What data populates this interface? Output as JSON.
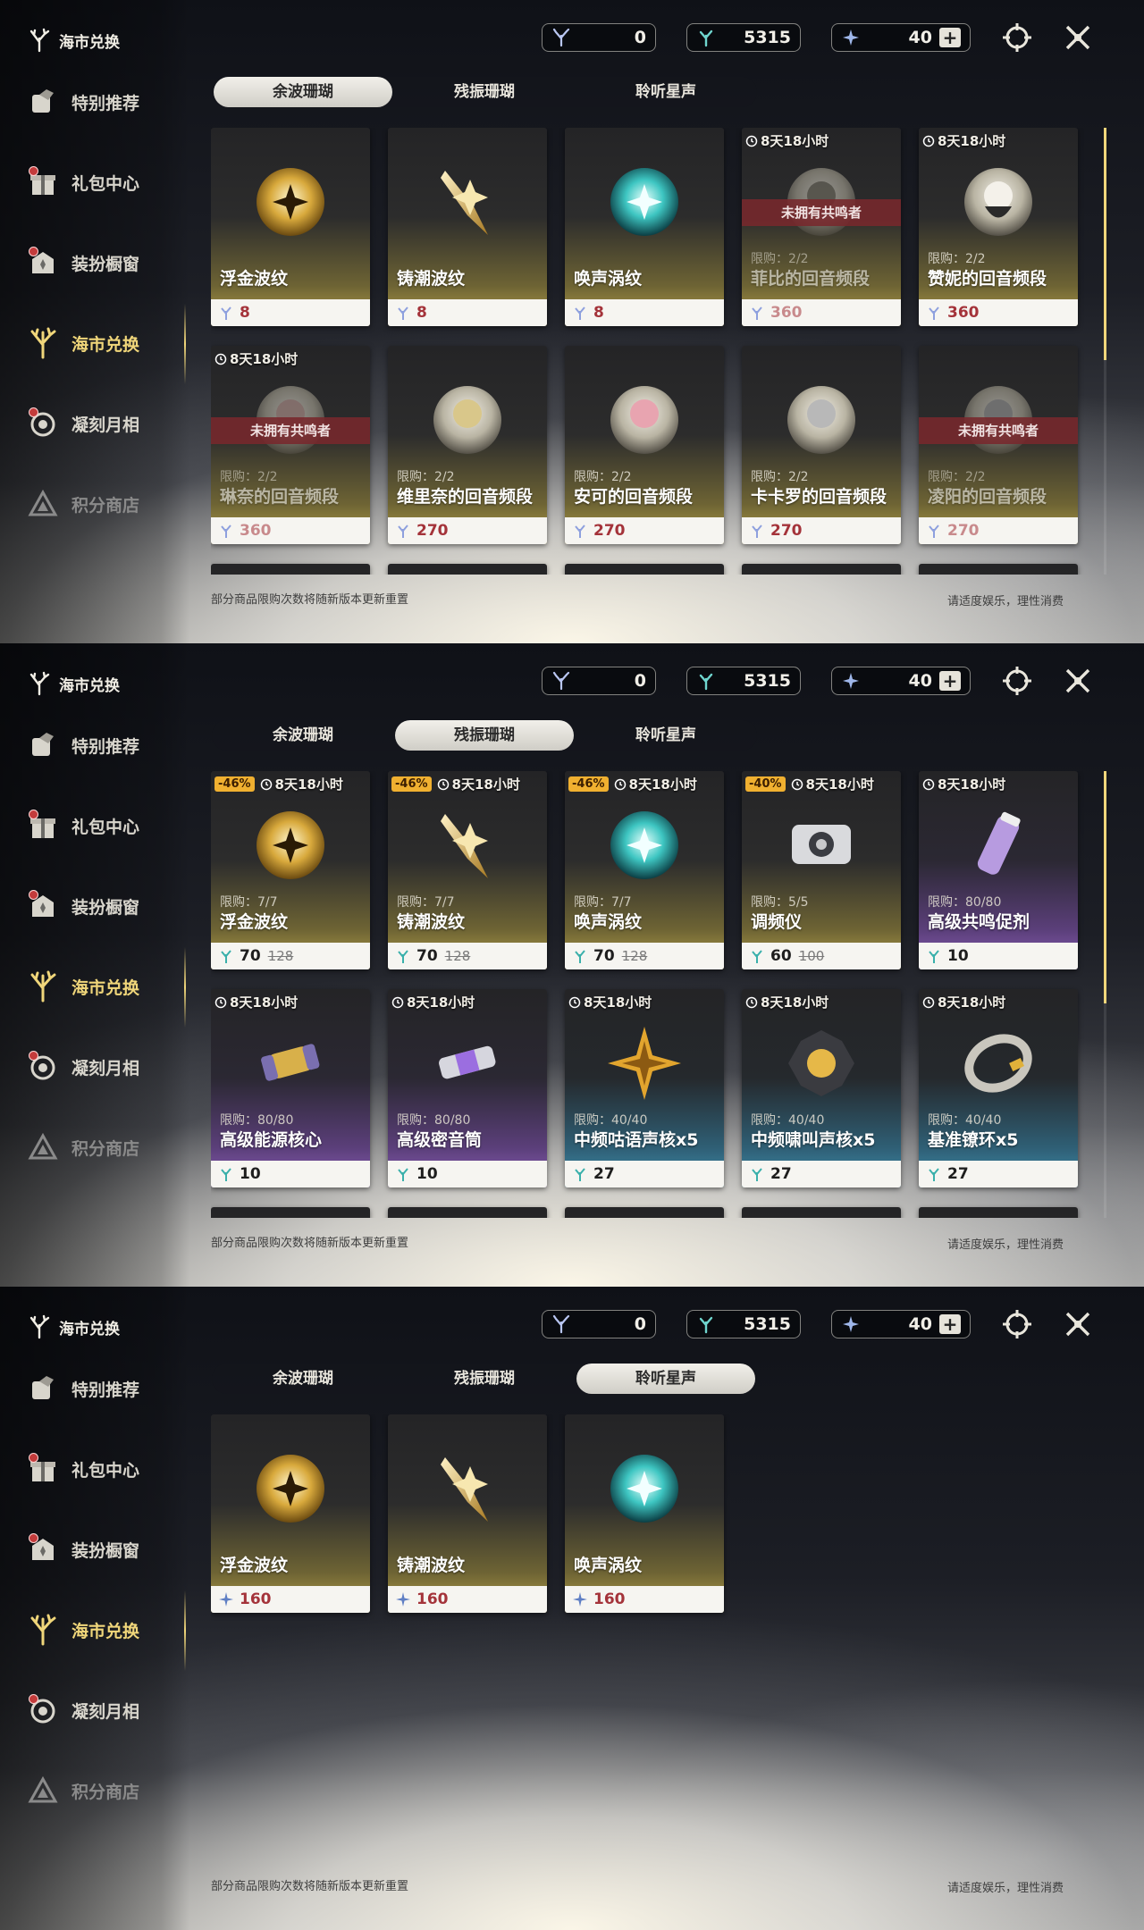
{
  "sidebar": {
    "title": "海市兑换",
    "items": [
      {
        "label": "特别推荐",
        "icon": "special-recommend-icon"
      },
      {
        "label": "礼包中心",
        "icon": "gift-icon"
      },
      {
        "label": "装扮橱窗",
        "icon": "wardrobe-icon"
      },
      {
        "label": "海市兑换",
        "icon": "coral-tree-icon"
      },
      {
        "label": "凝刻月相",
        "icon": "moon-phase-icon"
      },
      {
        "label": "积分商店",
        "icon": "triangle-shop-icon"
      }
    ]
  },
  "currencies": {
    "c1": "0",
    "c2": "5315",
    "c3": "40"
  },
  "tabs": [
    "余波珊瑚",
    "残振珊瑚",
    "聆听星声"
  ],
  "footer": {
    "note": "部分商品限购次数将随新版本更新重置",
    "right": "请适度娱乐，理性消费"
  },
  "panel1": {
    "active_tab": 0,
    "cards": [
      {
        "name": "浮金波纹",
        "price": "8",
        "timer": "",
        "limit": "",
        "banner": ""
      },
      {
        "name": "铸潮波纹",
        "price": "8",
        "timer": "",
        "limit": "",
        "banner": ""
      },
      {
        "name": "唤声涡纹",
        "price": "8",
        "timer": "",
        "limit": "",
        "banner": ""
      },
      {
        "name": "菲比的回音频段",
        "price": "360",
        "timer": "8天18小时",
        "limit": "限购：2/2",
        "banner": "未拥有共鸣者"
      },
      {
        "name": "赞妮的回音频段",
        "price": "360",
        "timer": "8天18小时",
        "limit": "限购：2/2",
        "banner": ""
      },
      {
        "name": "琳奈的回音频段",
        "price": "360",
        "timer": "8天18小时",
        "limit": "限购：2/2",
        "banner": "未拥有共鸣者"
      },
      {
        "name": "维里奈的回音频段",
        "price": "270",
        "timer": "",
        "limit": "限购：2/2",
        "banner": ""
      },
      {
        "name": "安可的回音频段",
        "price": "270",
        "timer": "",
        "limit": "限购：2/2",
        "banner": ""
      },
      {
        "name": "卡卡罗的回音频段",
        "price": "270",
        "timer": "",
        "limit": "限购：2/2",
        "banner": ""
      },
      {
        "name": "凌阳的回音频段",
        "price": "270",
        "timer": "",
        "limit": "限购：2/2",
        "banner": "未拥有共鸣者"
      }
    ]
  },
  "panel2": {
    "active_tab": 1,
    "cards": [
      {
        "name": "浮金波纹",
        "price": "70",
        "old": "128",
        "discount": "-46%",
        "timer": "8天18小时",
        "limit": "限购：7/7"
      },
      {
        "name": "铸潮波纹",
        "price": "70",
        "old": "128",
        "discount": "-46%",
        "timer": "8天18小时",
        "limit": "限购：7/7"
      },
      {
        "name": "唤声涡纹",
        "price": "70",
        "old": "128",
        "discount": "-46%",
        "timer": "8天18小时",
        "limit": "限购：7/7"
      },
      {
        "name": "调频仪",
        "price": "60",
        "old": "100",
        "discount": "-40%",
        "timer": "8天18小时",
        "limit": "限购：5/5"
      },
      {
        "name": "高级共鸣促剂",
        "price": "10",
        "old": "",
        "discount": "",
        "timer": "8天18小时",
        "limit": "限购：80/80"
      },
      {
        "name": "高级能源核心",
        "price": "10",
        "old": "",
        "discount": "",
        "timer": "8天18小时",
        "limit": "限购：80/80"
      },
      {
        "name": "高级密音筒",
        "price": "10",
        "old": "",
        "discount": "",
        "timer": "8天18小时",
        "limit": "限购：80/80"
      },
      {
        "name": "中频咕语声核x5",
        "price": "27",
        "old": "",
        "discount": "",
        "timer": "8天18小时",
        "limit": "限购：40/40"
      },
      {
        "name": "中频啸叫声核x5",
        "price": "27",
        "old": "",
        "discount": "",
        "timer": "8天18小时",
        "limit": "限购：40/40"
      },
      {
        "name": "基准镣环x5",
        "price": "27",
        "old": "",
        "discount": "",
        "timer": "8天18小时",
        "limit": "限购：40/40"
      }
    ]
  },
  "panel3": {
    "active_tab": 2,
    "cards": [
      {
        "name": "浮金波纹",
        "price": "160"
      },
      {
        "name": "铸潮波纹",
        "price": "160"
      },
      {
        "name": "唤声涡纹",
        "price": "160"
      }
    ]
  }
}
